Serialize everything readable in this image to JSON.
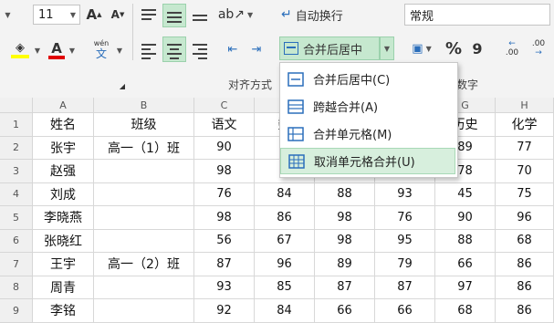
{
  "ribbon": {
    "font_size": "11",
    "grow_font_label": "A",
    "shrink_font_label": "A",
    "wrap_text_label": "自动换行",
    "number_format": "常规",
    "merge_center_label": "合并后居中",
    "percent_label": "%",
    "comma_label": "9",
    "dec_inc_label": ".00",
    "dec_dec_label": ".00",
    "font_color_label": "A",
    "phonetic_label": "wén",
    "phonetic_sub": "文",
    "group_alignment": "对齐方式",
    "group_number": "数字",
    "accent_fill": "#ffff00",
    "accent_font": "#e00000",
    "highlight": "#c6e8cf"
  },
  "columns": [
    "A",
    "B",
    "C",
    "D",
    "E",
    "F",
    "G",
    "H"
  ],
  "rows": [
    {
      "num": "1",
      "cells": [
        "姓名",
        "班级",
        "语文",
        "数",
        "",
        "",
        "历史",
        "化学"
      ]
    },
    {
      "num": "2",
      "cells": [
        "张宇",
        "高一（1）班",
        "90",
        "8",
        "",
        "",
        "89",
        "77"
      ]
    },
    {
      "num": "3",
      "cells": [
        "赵强",
        "",
        "98",
        "7",
        "",
        "",
        "78",
        "70"
      ]
    },
    {
      "num": "4",
      "cells": [
        "刘成",
        "",
        "76",
        "84",
        "88",
        "93",
        "45",
        "75"
      ]
    },
    {
      "num": "5",
      "cells": [
        "李晓燕",
        "",
        "98",
        "86",
        "98",
        "76",
        "90",
        "96"
      ]
    },
    {
      "num": "6",
      "cells": [
        "张晓红",
        "",
        "56",
        "67",
        "98",
        "95",
        "88",
        "68"
      ]
    },
    {
      "num": "7",
      "cells": [
        "王宇",
        "高一（2）班",
        "87",
        "96",
        "89",
        "79",
        "66",
        "86"
      ]
    },
    {
      "num": "8",
      "cells": [
        "周青",
        "",
        "93",
        "85",
        "87",
        "87",
        "97",
        "86"
      ]
    },
    {
      "num": "9",
      "cells": [
        "李铭",
        "",
        "92",
        "84",
        "66",
        "66",
        "68",
        "86"
      ]
    }
  ],
  "menu": [
    {
      "label": "合并后居中(C)",
      "icon": "merge-center-icon"
    },
    {
      "label": "跨越合并(A)",
      "icon": "merge-across-icon"
    },
    {
      "label": "合并单元格(M)",
      "icon": "merge-cells-icon"
    },
    {
      "label": "取消单元格合并(U)",
      "icon": "unmerge-cells-icon"
    }
  ]
}
